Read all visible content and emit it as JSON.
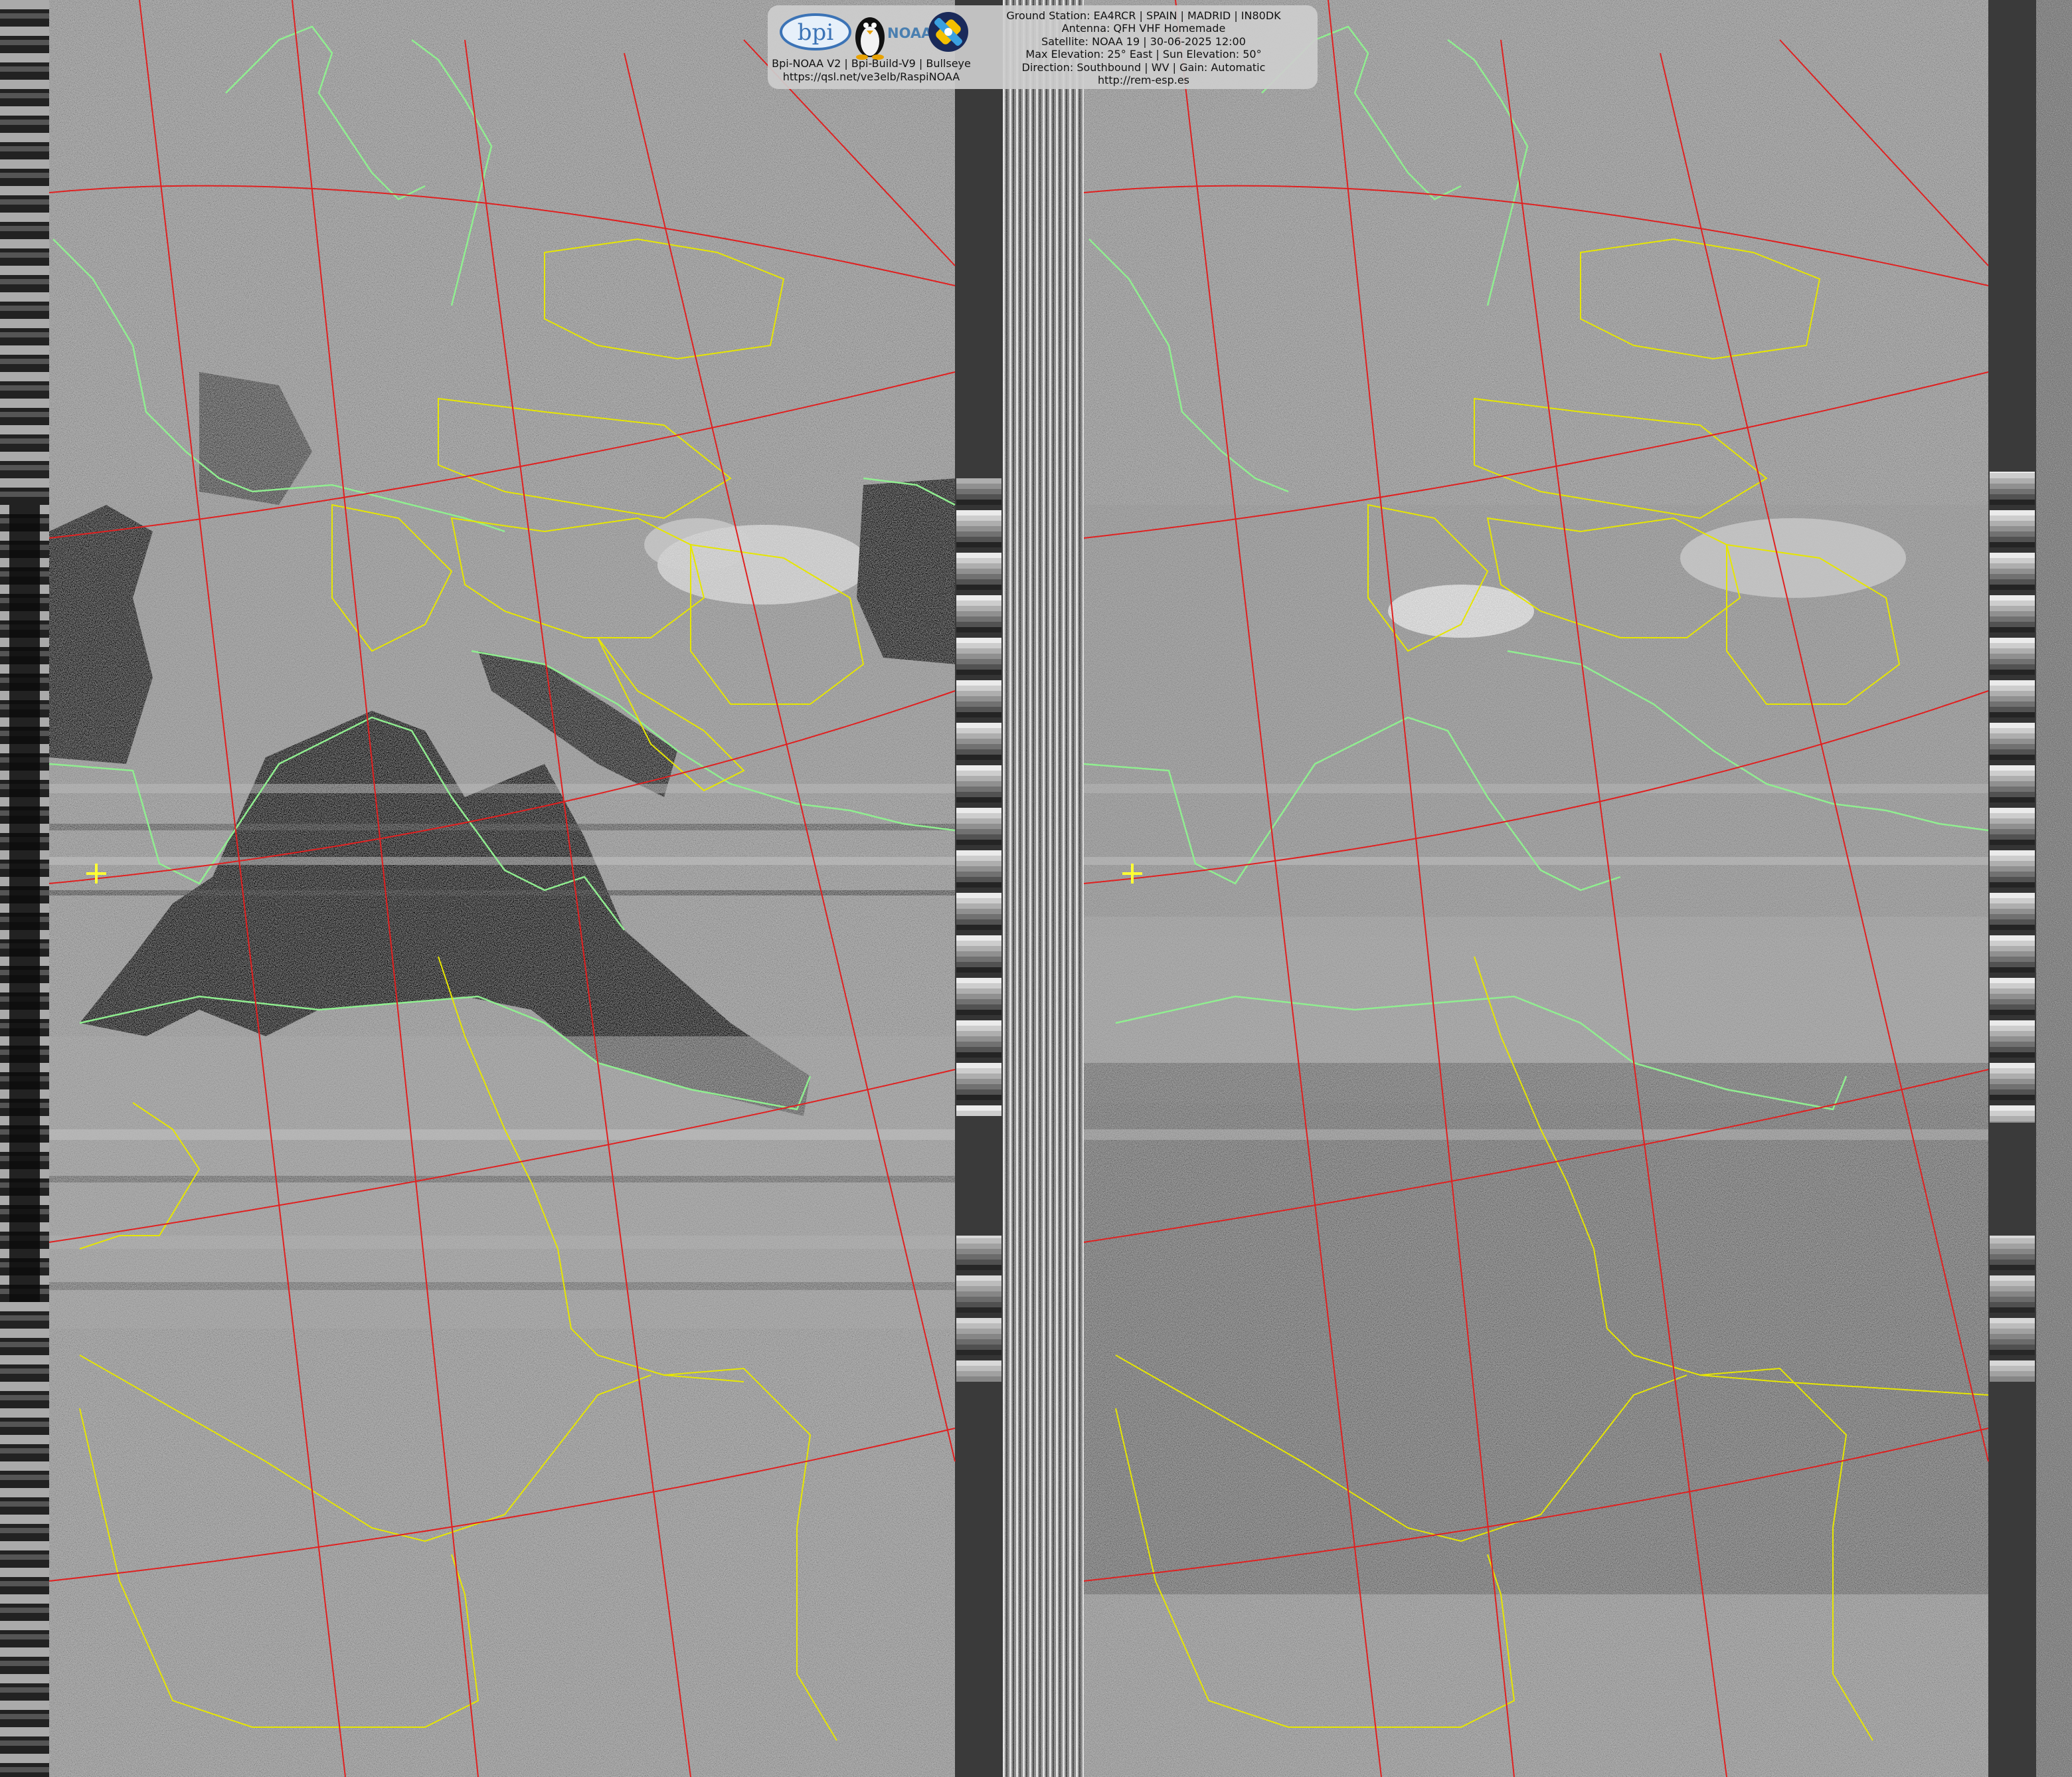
{
  "header": {
    "left_lines": [
      "Bpi-NOAA V2 | Bpi-Build-V9 | Bullseye",
      "https://qsl.net/ve3elb/RaspiNOAA"
    ],
    "right_lines": [
      "Ground Station: EA4RCR | SPAIN | MADRID | IN80DK",
      "Antenna: QFH VHF Homemade",
      "Satellite: NOAA 19 | 30-06-2025 12:00",
      "Max Elevation: 25° East | Sun Elevation: 50°",
      "Direction: Southbound | WV | Gain: Automatic",
      "http://rem-esp.es"
    ],
    "logos": {
      "bpi": "bpi",
      "noaa": "NOAA"
    }
  },
  "colors": {
    "graticule": "#e02020",
    "coastline": "#90ee90",
    "borders": "#e6e600",
    "marker": "#ffff33",
    "header_bg": "#cdcdcd"
  },
  "icons": [
    "bpi-logo-icon",
    "tux-penguin-icon",
    "noaa-logo-icon",
    "satellite-icon",
    "ground-station-marker-icon"
  ]
}
